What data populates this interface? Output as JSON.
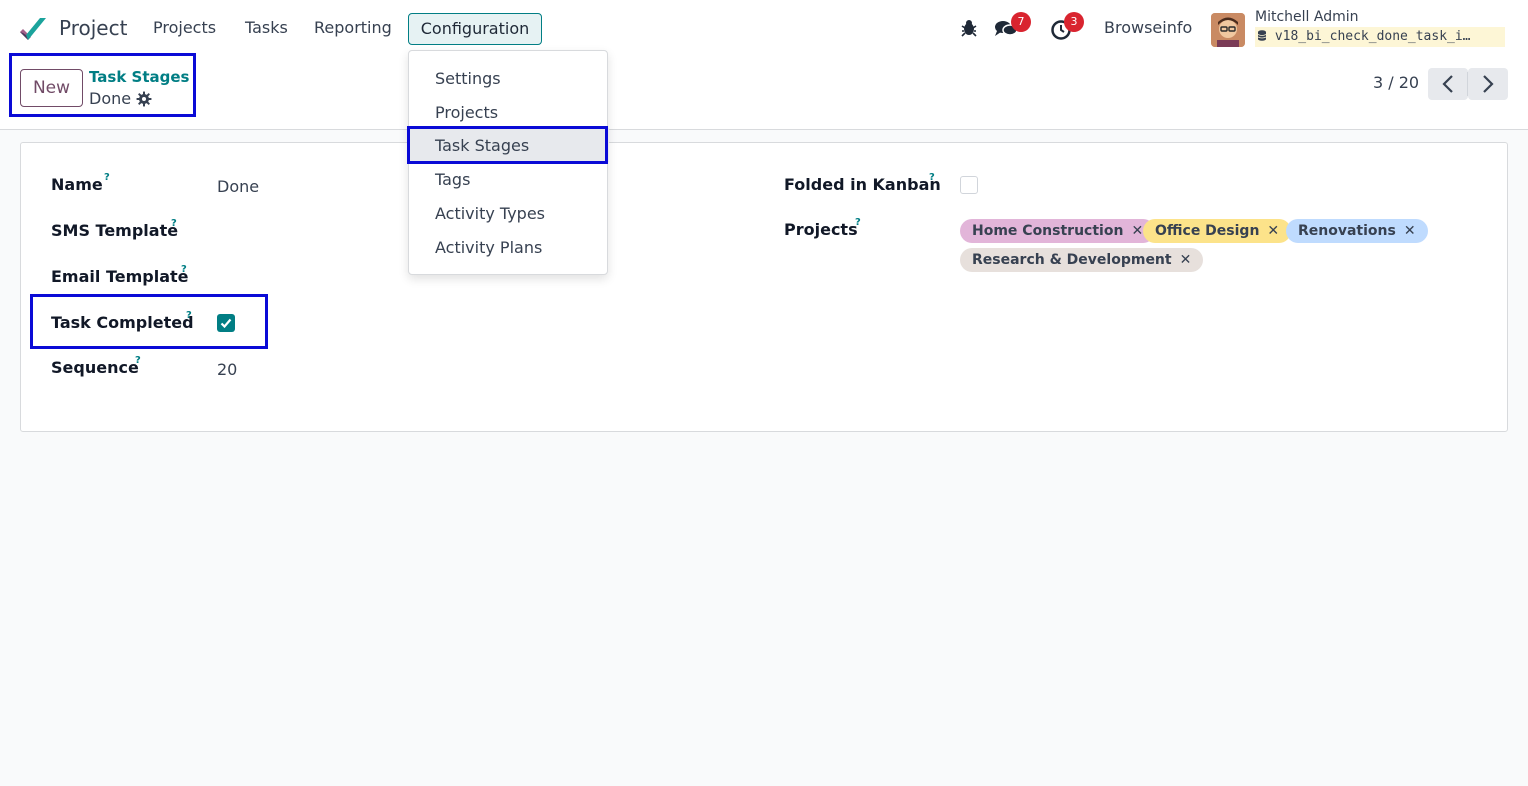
{
  "navbar": {
    "app_name": "Project",
    "menu": [
      "Projects",
      "Tasks",
      "Reporting",
      "Configuration"
    ],
    "messages_count": "7",
    "activities_count": "3",
    "company": "Browseinfo",
    "user_name": "Mitchell Admin",
    "db_name": "v18_bi_check_done_task_i…"
  },
  "dropdown": {
    "items": [
      "Settings",
      "Projects",
      "Task Stages",
      "Tags",
      "Activity Types",
      "Activity Plans"
    ],
    "active": "Task Stages"
  },
  "control": {
    "new_label": "New",
    "breadcrumb_parent": "Task Stages",
    "breadcrumb_current": "Done",
    "pager": "3 / 20"
  },
  "form": {
    "name_label": "Name",
    "name_value": "Done",
    "sms_template_label": "SMS Template",
    "email_template_label": "Email Template",
    "task_completed_label": "Task Completed",
    "task_completed": true,
    "sequence_label": "Sequence",
    "sequence_value": "20",
    "folded_label": "Folded in Kanban",
    "folded": false,
    "projects_label": "Projects",
    "help_mark": "?",
    "projects": [
      {
        "name": "Home Construction",
        "color": "#e2b5d9"
      },
      {
        "name": "Office Design",
        "color": "#fce38a"
      },
      {
        "name": "Renovations",
        "color": "#bfdbfe"
      },
      {
        "name": "Research & Development",
        "color": "#e7e0dc"
      }
    ]
  },
  "colors": {
    "primary": "#714b67",
    "accent": "#017e84",
    "highlight_box": "#0a0ad6",
    "badge": "#d9242f"
  }
}
